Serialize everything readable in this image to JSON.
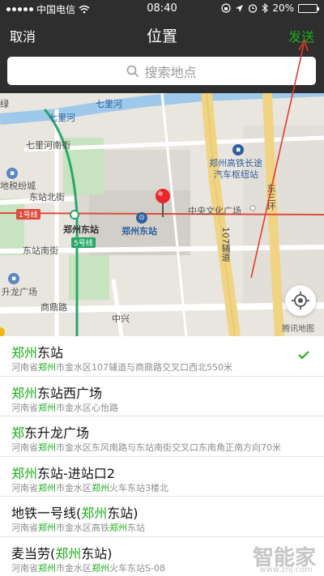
{
  "status_bar": {
    "carrier": "中国电信",
    "time": "08:40",
    "battery": "20%",
    "battery_level": 0.2
  },
  "navbar": {
    "cancel": "取消",
    "title": "位置",
    "send": "发送"
  },
  "search": {
    "placeholder": "搜索地点"
  },
  "map": {
    "labels": {
      "qilihe_1": "七里河",
      "qilihe_2": "七里河",
      "qilihe_south": "七里河南街",
      "difang": "地税纷城",
      "dongzhan_north": "东站北街",
      "line1": "1号线",
      "zz_east_metro": "郑州东站",
      "zz_east": "郑州东站",
      "line5": "5号线",
      "dongzhan_south": "东站南街",
      "shenglong": "升龙广场",
      "shangding": "商鼎路",
      "hsr_1": "郑州高铁长途",
      "hsr_2": "汽车枢纽站",
      "central_plaza": "中央文化广场",
      "dongsanhuan": "东三环",
      "road107": "107辅道",
      "zhongxing": "中兴",
      "tencent": "腾讯地图",
      "edge_left": "绿"
    },
    "colors": {
      "rail": "#e04a3a",
      "road": "#f0d483",
      "water": "#9ec9ea",
      "green": "#c8e3c0",
      "metro5": "#28a76b"
    }
  },
  "locations": [
    {
      "name_hl": "郑州",
      "name_rest": "东站",
      "addr_parts": [
        "河南省",
        "郑州",
        "市金水区107辅道与商鼎路交叉口西北550米"
      ],
      "selected": true
    },
    {
      "name_hl": "郑州",
      "name_rest": "东站西广场",
      "addr_parts": [
        "河南省",
        "郑州",
        "市金水区心怡路"
      ],
      "selected": false
    },
    {
      "name_hl": "郑",
      "name_rest": "东升龙广场",
      "addr_parts": [
        "河南省",
        "郑州",
        "市金水区东风南路与东站南街交叉口东南角正南方向70米"
      ],
      "selected": false
    },
    {
      "name_hl": "郑州",
      "name_rest": "东站-进站口2",
      "addr_parts": [
        "河南省",
        "郑州",
        "市金水区",
        "郑州",
        "火车东站3楼北"
      ],
      "selected": false
    },
    {
      "name_pre": "地铁一号线(",
      "name_hl": "郑州",
      "name_rest": "东站)",
      "addr_parts": [
        "河南省",
        "郑州",
        "市金水区高铁",
        "郑州",
        "东站"
      ],
      "selected": false
    },
    {
      "name_pre": "麦当劳(",
      "name_hl": "郑州",
      "name_rest": "东站)",
      "addr_parts": [
        "河南省",
        "郑州",
        "市金水区",
        "郑州",
        "火车东站S-08"
      ],
      "selected": false
    }
  ],
  "watermark": {
    "text": "智能家",
    "url": "www.znj.com"
  }
}
